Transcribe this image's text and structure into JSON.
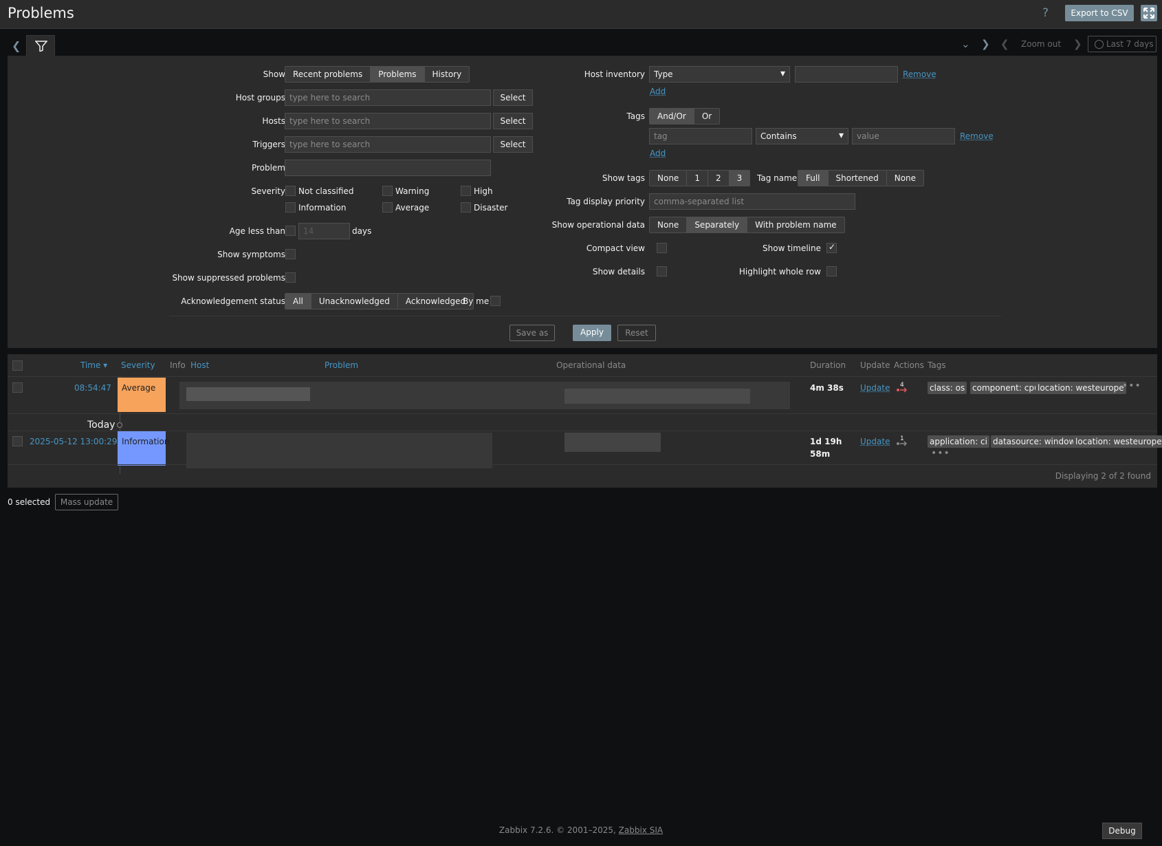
{
  "page": {
    "title": "Problems",
    "help": "?",
    "export_label": "Export to CSV"
  },
  "filterbar": {
    "zoom_out": "Zoom out",
    "time_range": "Last 7 days"
  },
  "filter": {
    "show": {
      "label": "Show",
      "options": [
        "Recent problems",
        "Problems",
        "History"
      ],
      "selected": "Problems"
    },
    "host_groups": {
      "label": "Host groups",
      "placeholder": "type here to search",
      "button": "Select"
    },
    "hosts": {
      "label": "Hosts",
      "placeholder": "type here to search",
      "button": "Select"
    },
    "triggers": {
      "label": "Triggers",
      "placeholder": "type here to search",
      "button": "Select"
    },
    "problem": {
      "label": "Problem",
      "value": ""
    },
    "severity": {
      "label": "Severity",
      "items": [
        "Not classified",
        "Warning",
        "High",
        "Information",
        "Average",
        "Disaster"
      ]
    },
    "age": {
      "label": "Age less than",
      "value": "14",
      "unit": "days"
    },
    "show_symptoms": {
      "label": "Show symptoms"
    },
    "show_suppressed": {
      "label": "Show suppressed problems"
    },
    "ack": {
      "label": "Acknowledgement status",
      "options": [
        "All",
        "Unacknowledged",
        "Acknowledged"
      ],
      "selected": "All",
      "by_me": "By me"
    },
    "host_inventory": {
      "label": "Host inventory",
      "type_value": "Type",
      "value": "",
      "remove": "Remove",
      "add": "Add"
    },
    "tags": {
      "label": "Tags",
      "options": [
        "And/Or",
        "Or"
      ],
      "selected": "And/Or",
      "tag_placeholder": "tag",
      "operator": "Contains",
      "value_placeholder": "value",
      "remove": "Remove",
      "add": "Add"
    },
    "show_tags": {
      "label": "Show tags",
      "options": [
        "None",
        "1",
        "2",
        "3"
      ],
      "selected": "3"
    },
    "tag_name": {
      "label": "Tag name",
      "options": [
        "Full",
        "Shortened",
        "None"
      ],
      "selected": "Full"
    },
    "tag_priority": {
      "label": "Tag display priority",
      "placeholder": "comma-separated list"
    },
    "operational_data": {
      "label": "Show operational data",
      "options": [
        "None",
        "Separately",
        "With problem name"
      ],
      "selected": "Separately"
    },
    "compact_view": {
      "label": "Compact view",
      "checked": false
    },
    "show_timeline": {
      "label": "Show timeline",
      "checked": true
    },
    "show_details": {
      "label": "Show details",
      "checked": false
    },
    "highlight_row": {
      "label": "Highlight whole row",
      "checked": false
    },
    "buttons": {
      "save_as": "Save as",
      "apply": "Apply",
      "reset": "Reset"
    }
  },
  "table": {
    "headers": {
      "time": "Time ▾",
      "severity": "Severity",
      "info": "Info",
      "host": "Host",
      "problem": "Problem",
      "operational_data": "Operational data",
      "duration": "Duration",
      "update": "Update",
      "actions": "Actions",
      "tags": "Tags"
    },
    "rows": [
      {
        "time": "08:54:47",
        "severity": "Average",
        "severity_color": "#f7a35c",
        "duration": "4m 38s",
        "update": "Update",
        "actions_count": "4",
        "tags": [
          "class: os",
          "component: cpu",
          "location: westeurope"
        ]
      },
      {
        "time": "2025-05-12 13:00:29",
        "severity": "Information",
        "severity_color": "#7498ff",
        "duration": [
          "1d 19h",
          "58m"
        ],
        "update": "Update",
        "actions_count": "1",
        "tags": [
          "application: ci",
          "datasource: windows",
          "location: westeurope"
        ]
      }
    ],
    "today_label": "Today",
    "footer": "Displaying 2 of 2 found"
  },
  "bulk": {
    "selected": "0 selected",
    "mass_update": "Mass update"
  },
  "footer": {
    "copyright": "Zabbix 7.2.6. © 2001–2025,",
    "company": "Zabbix SIA",
    "debug": "Debug"
  }
}
